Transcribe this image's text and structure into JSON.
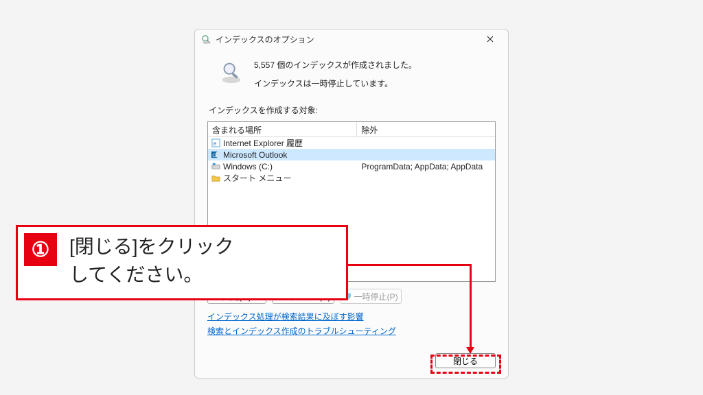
{
  "dialog": {
    "title": "インデックスのオプション",
    "status_count_line": "5,557 個のインデックスが作成されました。",
    "status_state_line": "インデックスは一時停止しています。",
    "section_label": "インデックスを作成する対象:",
    "columns": {
      "included": "含まれる場所",
      "excluded": "除外"
    },
    "rows": [
      {
        "icon": "ie-icon",
        "name": "Internet Explorer 履歴",
        "excluded": "",
        "selected": false
      },
      {
        "icon": "outlook-icon",
        "name": "Microsoft Outlook",
        "excluded": "",
        "selected": true
      },
      {
        "icon": "drive-icon",
        "name": "Windows (C:)",
        "excluded": "ProgramData; AppData; AppData",
        "selected": false
      },
      {
        "icon": "folder-icon",
        "name": "スタート メニュー",
        "excluded": "",
        "selected": false
      }
    ],
    "buttons": {
      "modify": "変更(M)",
      "advanced": "詳細設定(D)",
      "pause": "一時停止(P)",
      "close": "閉じる"
    },
    "links": {
      "impact": "インデックス処理が検索結果に及ぼす影響",
      "troubleshoot": "検索とインデックス作成のトラブルシューティング"
    }
  },
  "annotation": {
    "step": "①",
    "text": "[閉じる]をクリック\nしてください。"
  }
}
